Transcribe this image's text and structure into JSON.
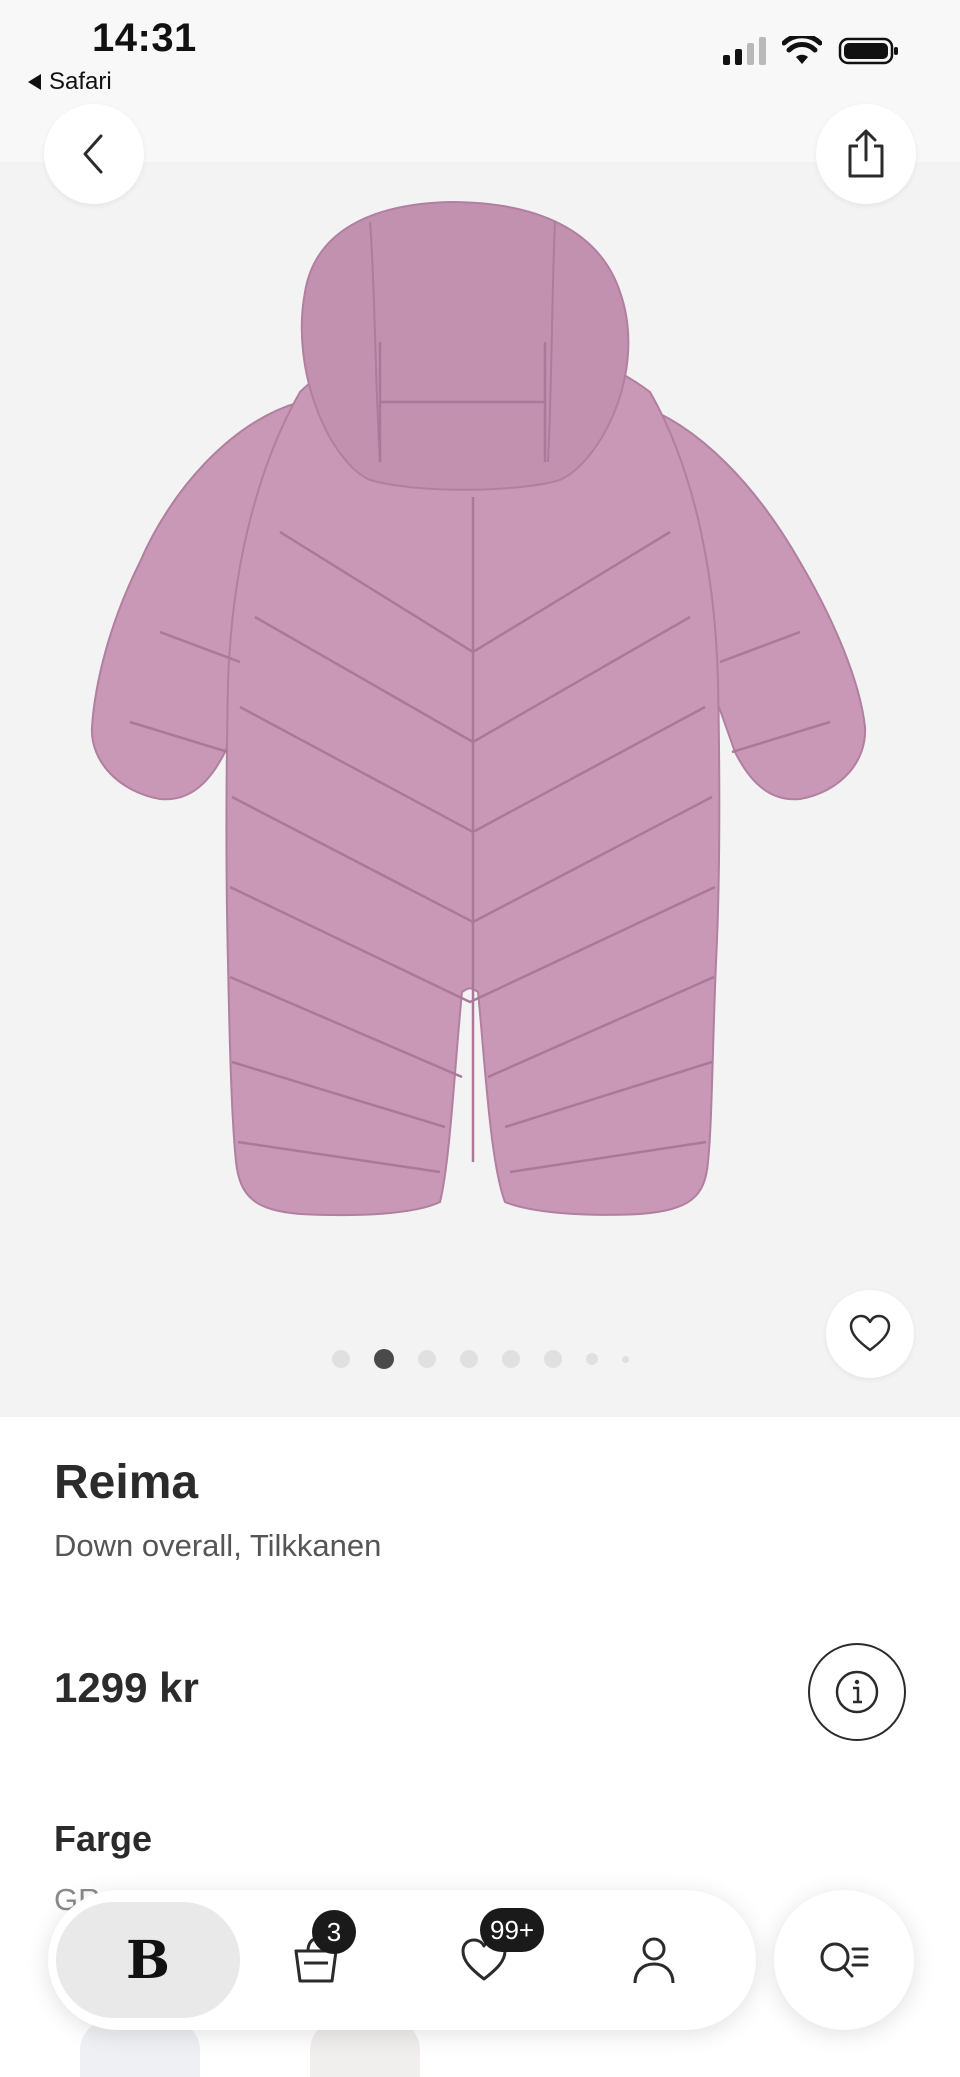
{
  "status_bar": {
    "time": "14:31",
    "back_app": "Safari"
  },
  "gallery": {
    "image_count": 8,
    "active_index": 1,
    "product_color": "#c596b3"
  },
  "product": {
    "brand": "Reima",
    "name": "Down overall, Tilkkanen",
    "price": "1299 kr",
    "color_label": "Farge",
    "color_value": "GR"
  },
  "bottom_nav": {
    "home_label": "B",
    "cart_badge": "3",
    "favorites_badge": "99+"
  },
  "icons": {
    "back": "chevron-left-icon",
    "share": "share-icon",
    "favorite": "heart-icon",
    "info": "info-icon",
    "cart": "bag-icon",
    "wishlist": "heart-icon",
    "account": "person-icon",
    "search": "search-menu-icon"
  }
}
